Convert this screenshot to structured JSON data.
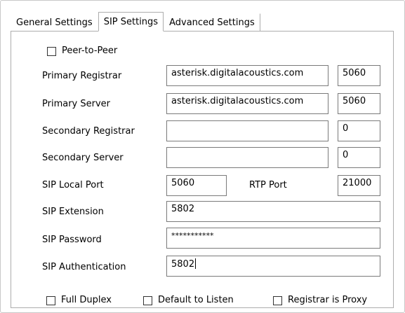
{
  "tabs": [
    {
      "label": "General Settings"
    },
    {
      "label": "SIP Settings",
      "active": true
    },
    {
      "label": "Advanced Settings"
    }
  ],
  "peer_to_peer": {
    "label": "Peer-to-Peer",
    "checked": false
  },
  "rows": {
    "primary_registrar": {
      "label": "Primary Registrar",
      "host": "asterisk.digitalacoustics.com",
      "port": "5060"
    },
    "primary_server": {
      "label": "Primary Server",
      "host": "asterisk.digitalacoustics.com",
      "port": "5060"
    },
    "secondary_registrar": {
      "label": "Secondary Registrar",
      "host": "",
      "port": "0"
    },
    "secondary_server": {
      "label": "Secondary Server",
      "host": "",
      "port": "0"
    }
  },
  "sip_local_port": {
    "label": "SIP Local Port",
    "value": "5060"
  },
  "rtp_port": {
    "label": "RTP Port",
    "value": "21000"
  },
  "sip_extension": {
    "label": "SIP Extension",
    "value": "5802"
  },
  "sip_password": {
    "label": "SIP Password",
    "value": "***********"
  },
  "sip_authentication": {
    "label": "SIP Authentication",
    "value": "5802"
  },
  "options": {
    "full_duplex": {
      "label": "Full Duplex",
      "checked": false
    },
    "default_to_listen": {
      "label": "Default to Listen",
      "checked": false
    },
    "registrar_is_proxy": {
      "label": "Registrar is Proxy",
      "checked": false
    }
  }
}
